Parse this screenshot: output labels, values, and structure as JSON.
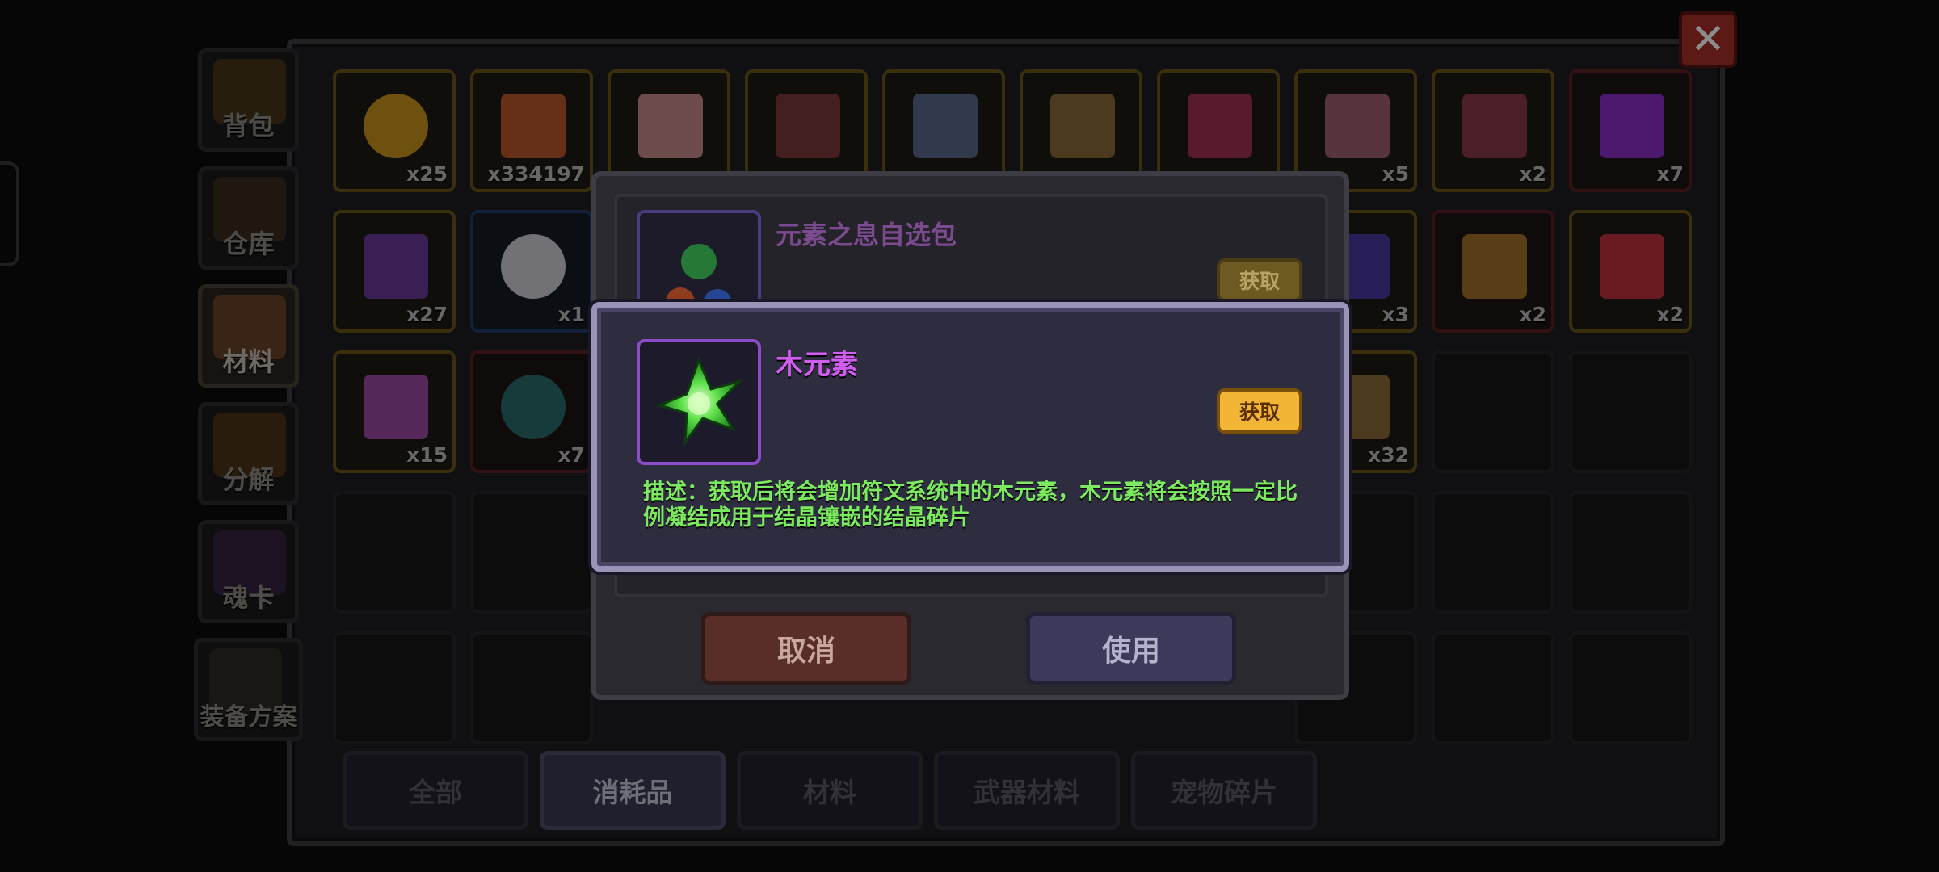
{
  "sidebar": {
    "items": [
      {
        "label": "背包"
      },
      {
        "label": "仓库"
      },
      {
        "label": "材料"
      },
      {
        "label": "分解"
      },
      {
        "label": "魂卡"
      },
      {
        "label": "装备方案"
      }
    ]
  },
  "grid": {
    "row1": [
      "x25",
      "x334197",
      "",
      "",
      "",
      "",
      "",
      "x5",
      "x2",
      "x7"
    ],
    "row2": [
      "x27",
      "x1",
      "",
      "",
      "",
      "",
      "",
      "x3",
      "x2",
      "x2"
    ],
    "row3": [
      "x15",
      "x7",
      "",
      "",
      "",
      "",
      "",
      "x32",
      "",
      ""
    ]
  },
  "categories": [
    "全部",
    "消耗品",
    "材料",
    "武器材料",
    "宠物碎片"
  ],
  "close_icon": "close-icon",
  "pack_dialog": {
    "title": "元素之息自选包",
    "get_label": "获取",
    "cancel_label": "取消",
    "use_label": "使用"
  },
  "detail_dialog": {
    "title": "木元素",
    "get_label": "获取",
    "description": "描述：获取后将会增加符文系统中的木元素，木元素将会按照一定比例凝结成用于结晶镶嵌的结晶碎片"
  },
  "colors": {
    "title_purple": "#d15cf0",
    "desc_green": "#7bea5e",
    "get_gold": "#f3b536",
    "close_red": "#a8302b"
  }
}
